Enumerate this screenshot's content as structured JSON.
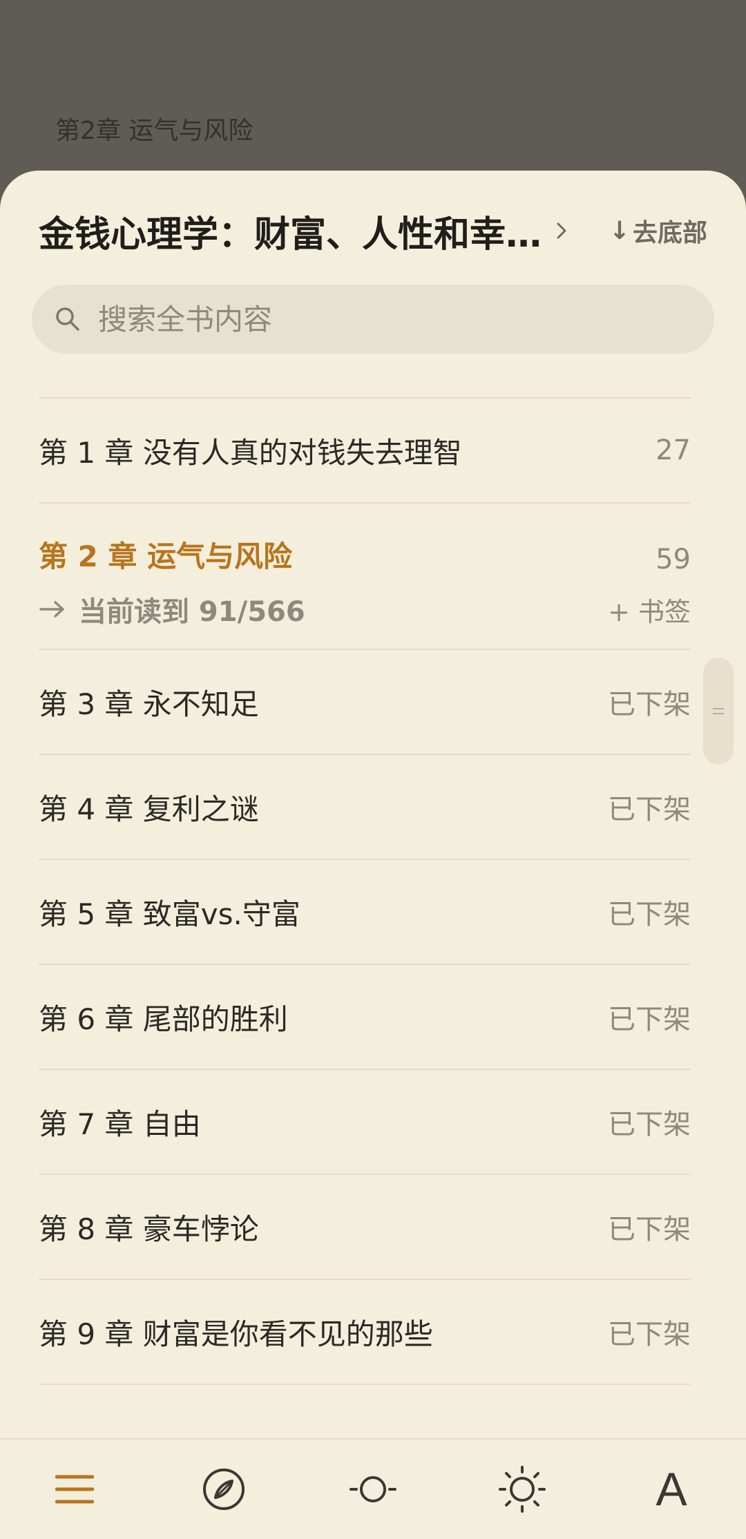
{
  "background": {
    "chapter_title": "第2章 运气与风险"
  },
  "header": {
    "book_title": "金钱心理学：财富、人性和幸…",
    "go_bottom_label": "去底部"
  },
  "search": {
    "placeholder": "搜索全书内容"
  },
  "toc": [
    {
      "label": "第 1 章  没有人真的对钱失去理智",
      "right": "27"
    },
    {
      "label": "第 2 章  运气与风险",
      "right": "59",
      "current": true
    },
    {
      "label": "第 3 章  永不知足",
      "right": "已下架"
    },
    {
      "label": "第 4 章  复利之谜",
      "right": "已下架"
    },
    {
      "label": "第 5 章  致富vs.守富",
      "right": "已下架"
    },
    {
      "label": "第 6 章  尾部的胜利",
      "right": "已下架"
    },
    {
      "label": "第 7 章  自由",
      "right": "已下架"
    },
    {
      "label": "第 8 章  豪车悖论",
      "right": "已下架"
    },
    {
      "label": "第 9 章  财富是你看不见的那些",
      "right": "已下架"
    }
  ],
  "current_progress": {
    "text": "当前读到 91/566",
    "bookmark_label": "+ 书签"
  },
  "colors": {
    "accent": "#b8741e",
    "sheet_bg": "#f4efdc",
    "overlay_bg": "#5f5c55"
  },
  "bottom_bar": {
    "tabs": [
      "toc-icon",
      "compass-icon",
      "brightness-low-icon",
      "brightness-high-icon",
      "font-icon"
    ],
    "font_tab_label": "A"
  }
}
